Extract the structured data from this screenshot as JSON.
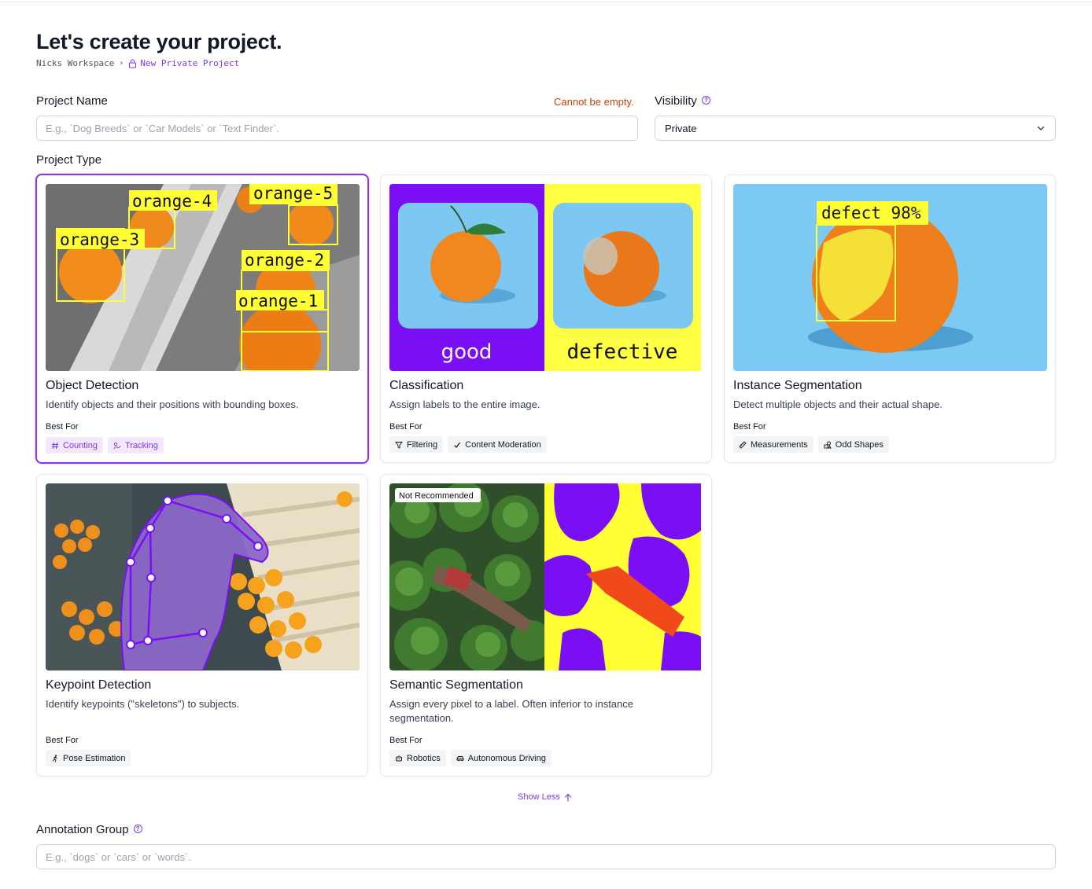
{
  "page": {
    "title": "Let's create your project.",
    "breadcrumb": {
      "workspace": "Nicks Workspace",
      "current": "New Private Project"
    }
  },
  "form": {
    "project_name": {
      "label": "Project Name",
      "error": "Cannot be empty.",
      "placeholder": "E.g., `Dog Breeds` or `Car Models` or `Text Finder`.",
      "value": ""
    },
    "visibility": {
      "label": "Visibility",
      "value": "Private"
    },
    "project_type": {
      "label": "Project Type"
    },
    "annotation_group": {
      "label": "Annotation Group",
      "placeholder": "E.g., `dogs` or `cars` or `words`.",
      "value": ""
    }
  },
  "project_types": [
    {
      "title": "Object Detection",
      "description": "Identify objects and their positions with bounding boxes.",
      "best_for_label": "Best For",
      "selected": true,
      "tags": [
        {
          "label": "Counting",
          "icon": "hash-icon"
        },
        {
          "label": "Tracking",
          "icon": "tracking-icon"
        }
      ],
      "image_labels": [
        "orange-5",
        "orange-4",
        "orange-3",
        "orange-2",
        "orange-1"
      ]
    },
    {
      "title": "Classification",
      "description": "Assign labels to the entire image.",
      "best_for_label": "Best For",
      "selected": false,
      "tags": [
        {
          "label": "Filtering",
          "icon": "filter-icon"
        },
        {
          "label": "Content Moderation",
          "icon": "check-icon"
        }
      ],
      "image_labels": [
        "good",
        "defective"
      ]
    },
    {
      "title": "Instance Segmentation",
      "description": "Detect multiple objects and their actual shape.",
      "best_for_label": "Best For",
      "selected": false,
      "tags": [
        {
          "label": "Measurements",
          "icon": "ruler-icon"
        },
        {
          "label": "Odd Shapes",
          "icon": "shapes-icon"
        }
      ],
      "image_labels": [
        "defect 98%"
      ]
    },
    {
      "title": "Keypoint Detection",
      "description": "Identify keypoints (\"skeletons\") to subjects.",
      "best_for_label": "Best For",
      "selected": false,
      "tags": [
        {
          "label": "Pose Estimation",
          "icon": "running-person-icon"
        }
      ]
    },
    {
      "title": "Semantic Segmentation",
      "description": "Assign every pixel to a label. Often inferior to instance segmentation.",
      "best_for_label": "Best For",
      "selected": false,
      "badge": "Not Recommended",
      "tags": [
        {
          "label": "Robotics",
          "icon": "robot-icon"
        },
        {
          "label": "Autonomous Driving",
          "icon": "car-icon"
        }
      ]
    }
  ],
  "show_less_label": "Show Less",
  "colors": {
    "accent": "#9333ea",
    "accent_text": "#7c3aed",
    "error": "#c2410c",
    "annotation_yellow": "#ffff33",
    "class_purple": "#7a0ff5",
    "sky_blue": "#77c6f2"
  }
}
